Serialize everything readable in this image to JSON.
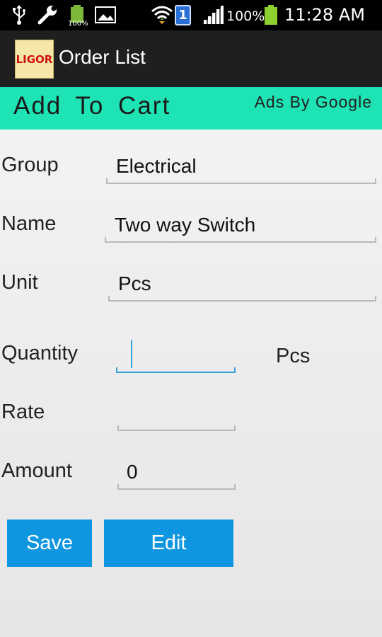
{
  "status_bar": {
    "battery_badge": "100%",
    "notification_count": "1",
    "battery_percent": "100%",
    "time": "11:28 AM"
  },
  "action_bar": {
    "logo_text": "LIGOR",
    "title": "Order List"
  },
  "header": {
    "title": "Add To Cart",
    "ads_label": "Ads By Google",
    "color": "#1ee3b4"
  },
  "form": {
    "group": {
      "label": "Group",
      "value": "Electrical"
    },
    "name": {
      "label": "Name",
      "value": "Two way Switch"
    },
    "unit": {
      "label": "Unit",
      "value": "Pcs"
    },
    "quantity": {
      "label": "Quantity",
      "value": "",
      "unit_suffix": "Pcs"
    },
    "rate": {
      "label": "Rate",
      "value": ""
    },
    "amount": {
      "label": "Amount",
      "value": "0"
    }
  },
  "buttons": {
    "save_label": "Save",
    "edit_label": "Edit",
    "color": "#0e96e0"
  }
}
